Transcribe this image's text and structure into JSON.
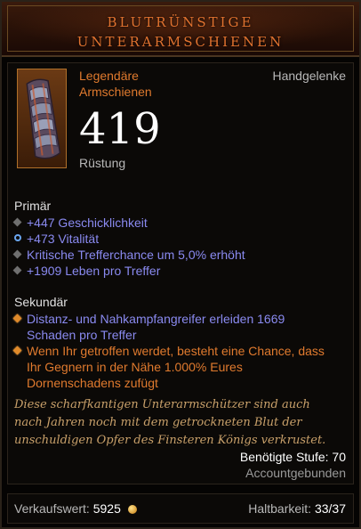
{
  "item": {
    "name_line1": "BLUTRÜNSTIGE",
    "name_line2": "UNTERARMSCHIENEN",
    "type_line1": "Legendäre",
    "type_line2": "Armschienen",
    "slot": "Handgelenke",
    "armor_value": "419",
    "armor_label": "Rüstung",
    "icon": "bracers-icon"
  },
  "primary": {
    "heading": "Primär",
    "affixes": [
      {
        "text": "+447 Geschicklichkeit",
        "bullet": "grey-diamond"
      },
      {
        "text": "+473 Vitalität",
        "bullet": "vitality-ring"
      },
      {
        "text": "Kritische Trefferchance um 5,0% erhöht",
        "bullet": "grey-diamond"
      },
      {
        "text": "+1909 Leben pro Treffer",
        "bullet": "grey-diamond"
      }
    ]
  },
  "secondary": {
    "heading": "Sekundär",
    "affixes": [
      {
        "line1": "Distanz- und Nahkampfangreifer erleiden 1669",
        "line2": "Schaden pro Treffer",
        "color": "blue",
        "bullet": "gold-diamond"
      },
      {
        "line1": "Wenn Ihr getroffen werdet, besteht eine Chance, dass",
        "line2": "Ihr Gegnern in der Nähe 1.000% Eures",
        "line3": "Dornenschadens zufügt",
        "color": "orange",
        "bullet": "gold-diamond"
      }
    ]
  },
  "flavor": {
    "line1": "Diese scharfkantigen Unterarmschützer sind auch",
    "line2": "nach Jahren noch mit dem getrockneten Blut der",
    "line3": "unschuldigen Opfer des Finsteren Königs verkrustet."
  },
  "requirements": {
    "level": "Benötigte Stufe: 70",
    "binding": "Accountgebunden"
  },
  "footer": {
    "sell_label": "Verkaufswert:",
    "sell_value": "5925",
    "durability_label": "Haltbarkeit:",
    "durability_value": "33/37"
  },
  "colors": {
    "legendary": "#e07a2e",
    "magic": "#8a8af0",
    "flavor": "#c8a06a"
  }
}
